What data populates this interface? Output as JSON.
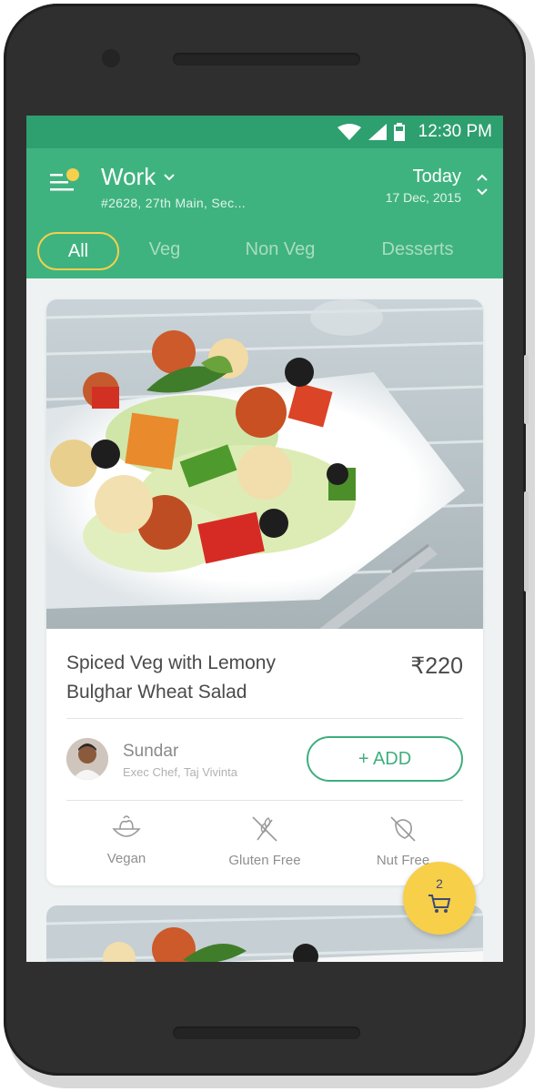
{
  "status_bar": {
    "time": "12:30 PM"
  },
  "header": {
    "location_title": "Work",
    "location_address": "#2628, 27th Main, Sec...",
    "day_label": "Today",
    "date": "17 Dec, 2015"
  },
  "tabs": [
    {
      "label": "All",
      "active": true
    },
    {
      "label": "Veg",
      "active": false
    },
    {
      "label": "Non Veg",
      "active": false
    },
    {
      "label": "Desserts",
      "active": false
    }
  ],
  "dish": {
    "name_line1": "Spiced Veg with Lemony",
    "name_line2": "Bulghar Wheat Salad",
    "price": "₹220",
    "chef_name": "Sundar",
    "chef_title": "Exec Chef, Taj Vivinta",
    "add_label": "+ ADD",
    "tags": [
      "Vegan",
      "Gluten Free",
      "Nut Free"
    ]
  },
  "cart": {
    "count": "2",
    "icon": "cart-icon"
  },
  "colors": {
    "status_green": "#2e9f6f",
    "header_green": "#3fb37f",
    "accent_yellow": "#f6d04d",
    "button_green": "#3fae7d"
  }
}
